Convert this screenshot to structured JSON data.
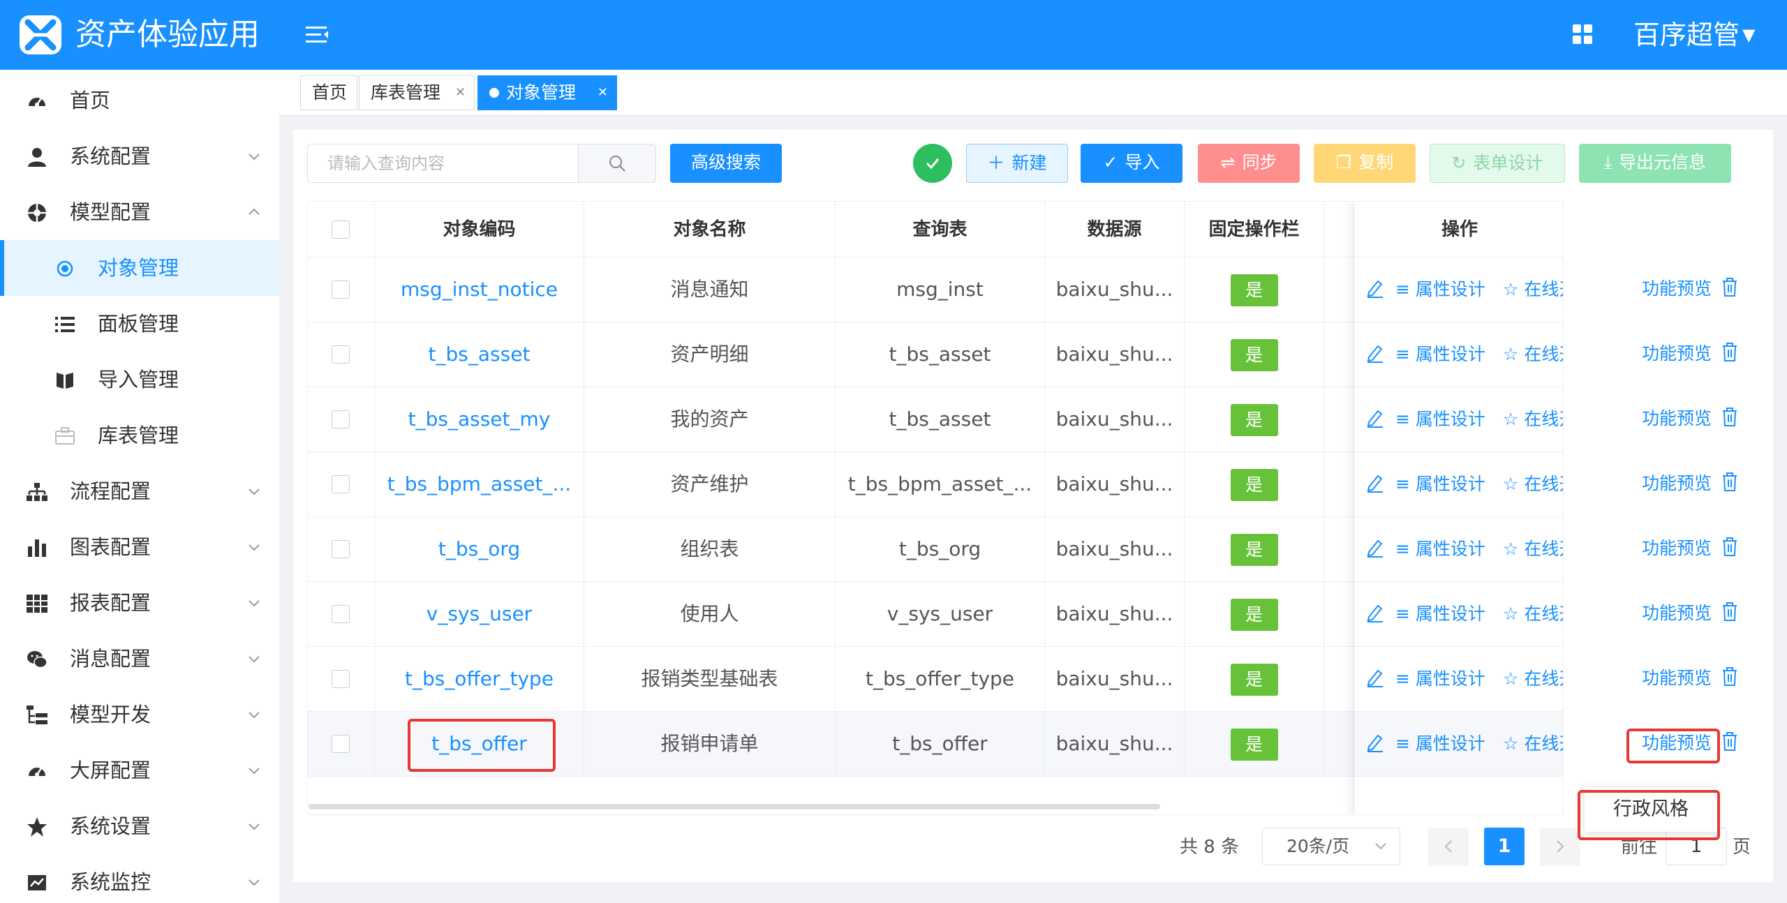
{
  "header": {
    "app_title": "资产体验应用",
    "user_name": "百序超管"
  },
  "sidebar": {
    "items": [
      {
        "label": "首页"
      },
      {
        "label": "系统配置"
      },
      {
        "label": "模型配置"
      },
      {
        "label": "对象管理"
      },
      {
        "label": "面板管理"
      },
      {
        "label": "导入管理"
      },
      {
        "label": "库表管理"
      },
      {
        "label": "流程配置"
      },
      {
        "label": "图表配置"
      },
      {
        "label": "报表配置"
      },
      {
        "label": "消息配置"
      },
      {
        "label": "模型开发"
      },
      {
        "label": "大屏配置"
      },
      {
        "label": "系统设置"
      },
      {
        "label": "系统监控"
      }
    ]
  },
  "tabs": [
    {
      "label": "首页"
    },
    {
      "label": "库表管理"
    },
    {
      "label": "对象管理"
    }
  ],
  "toolbar": {
    "search_placeholder": "请输入查询内容",
    "advanced_search": "高级搜索",
    "new": "新建",
    "import": "导入",
    "sync": "同步",
    "copy": "复制",
    "form_design": "表单设计",
    "export_meta": "导出元信息"
  },
  "colors": {
    "primary": "#1890ff",
    "success": "#67c23a",
    "sync": "#ff8e8e",
    "copy": "#ffd777",
    "form_design": "#e3f9ec",
    "export": "#8de3b1",
    "highlight": "#e53935"
  },
  "table": {
    "columns": [
      "对象编码",
      "对象名称",
      "查询表",
      "数据源",
      "固定操作栏",
      "操作"
    ],
    "rows": [
      {
        "code": "msg_inst_notice",
        "name": "消息通知",
        "table": "msg_inst",
        "source": "baixu_shu...",
        "fixed": "是"
      },
      {
        "code": "t_bs_asset",
        "name": "资产明细",
        "table": "t_bs_asset",
        "source": "baixu_shu...",
        "fixed": "是"
      },
      {
        "code": "t_bs_asset_my",
        "name": "我的资产",
        "table": "t_bs_asset",
        "source": "baixu_shu...",
        "fixed": "是"
      },
      {
        "code": "t_bs_bpm_asset_...",
        "name": "资产维护",
        "table": "t_bs_bpm_asset_...",
        "source": "baixu_shu...",
        "fixed": "是"
      },
      {
        "code": "t_bs_org",
        "name": "组织表",
        "table": "t_bs_org",
        "source": "baixu_shu...",
        "fixed": "是"
      },
      {
        "code": "v_sys_user",
        "name": "使用人",
        "table": "v_sys_user",
        "source": "baixu_shu...",
        "fixed": "是"
      },
      {
        "code": "t_bs_offer_type",
        "name": "报销类型基础表",
        "table": "t_bs_offer_type",
        "source": "baixu_shu...",
        "fixed": "是"
      },
      {
        "code": "t_bs_offer",
        "name": "报销申请单",
        "table": "t_bs_offer",
        "source": "baixu_shu...",
        "fixed": "是"
      }
    ],
    "op_labels": {
      "attr_design": "属性设计",
      "online_dev": "在线开发",
      "preview": "功能预览"
    }
  },
  "dropdown": {
    "item": "行政风格"
  },
  "pagination": {
    "total": "共 8 条",
    "page_size": "20条/页",
    "current": "1",
    "goto_label": "前往",
    "goto_value": "1",
    "page_suffix": "页"
  }
}
